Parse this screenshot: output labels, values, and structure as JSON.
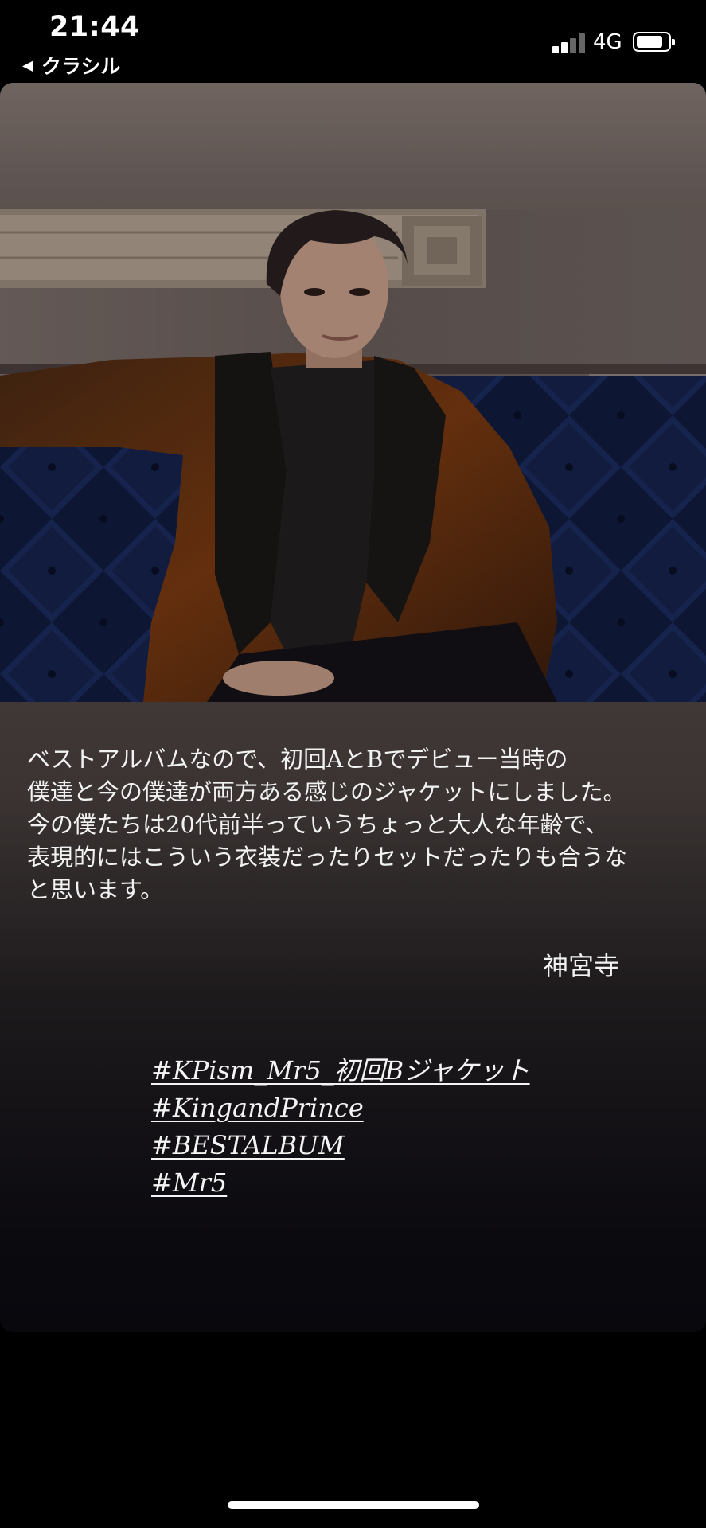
{
  "status_bar": {
    "time": "21:44",
    "back_label": "クラシル",
    "network": "4G",
    "signal_bars_active": 2,
    "signal_bars_total": 4
  },
  "story": {
    "photo_icon": "person-portrait-photo",
    "caption": "ベストアルバムなので、初回AとBでデビュー当時の\n僕達と今の僕達が両方ある感じのジャケットにしました。\n今の僕たちは20代前半っていうちょっと大人な年齢で、\n表現的にはこういう衣装だったりセットだったりも合うな\nと思います。",
    "signature": "神宮寺",
    "hashtags": [
      "#KPism_Mr5_初回Bジャケット",
      "#KingandPrince",
      "#BESTALBUM",
      "#Mr5"
    ]
  },
  "colors": {
    "background": "#000000",
    "card_top": "#6f6460",
    "card_bottom": "#08080d",
    "sofa_blue": "#1b2a5c",
    "text": "#f2f2f2"
  }
}
